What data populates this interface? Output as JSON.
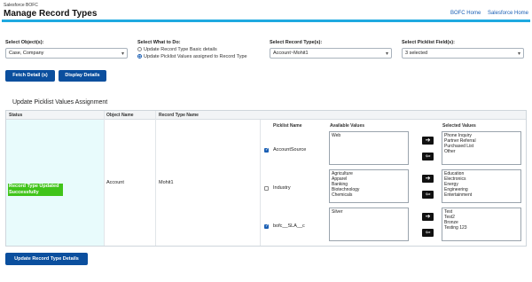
{
  "header": {
    "app_name": "Salesforce BOFC",
    "title": "Manage Record Types",
    "links": [
      "BOFC Home",
      "Salesforce Home"
    ]
  },
  "colors": {
    "accent_bar": "#1fa9e0",
    "button": "#0b4f9e",
    "status_highlight": "#40c41a",
    "status_cell": "#e8fbfc"
  },
  "filters": {
    "objects_label": "Select Object(s):",
    "objects_value": "Case, Company",
    "what_label": "Select What to Do:",
    "what_options": [
      "Update Record Type Basic details",
      "Update Picklist Values assigned to Record Type"
    ],
    "what_selected": 1,
    "record_type_label": "Select Record Type(s):",
    "record_type_value": "Account~Mohit1",
    "picklist_label": "Select Picklist Field(s):",
    "picklist_value": "3 selected"
  },
  "buttons": {
    "fetch": "Fetch Detail (s)",
    "display": "Display Details",
    "update": "Update Record Type Details"
  },
  "section_title": "Update Picklist Values Assignment",
  "table": {
    "headers": [
      "Status",
      "Object Name",
      "Record Type Name"
    ],
    "status": "Record Type Updated Successfully",
    "object_name": "Account",
    "record_type_name": "Mohit1"
  },
  "picklists": {
    "headers": [
      "Picklist Name",
      "Available Values",
      "Selected Values"
    ],
    "rows": [
      {
        "name": "AccountSource",
        "checked": true,
        "available": [
          "Web"
        ],
        "selected": [
          "Phone Inquiry",
          "Partner Referral",
          "Purchased List",
          "Other"
        ]
      },
      {
        "name": "Industry",
        "checked": false,
        "available": [
          "Agriculture",
          "Apparel",
          "Banking",
          "Biotechnology",
          "Chemicals"
        ],
        "selected": [
          "Education",
          "Electronics",
          "Energy",
          "Engineering",
          "Entertainment"
        ]
      },
      {
        "name": "bofc__SLA__c",
        "checked": true,
        "available": [
          "Silver"
        ],
        "selected": [
          "Test",
          "Test2",
          "Bronze",
          "Testing 123"
        ]
      }
    ]
  }
}
